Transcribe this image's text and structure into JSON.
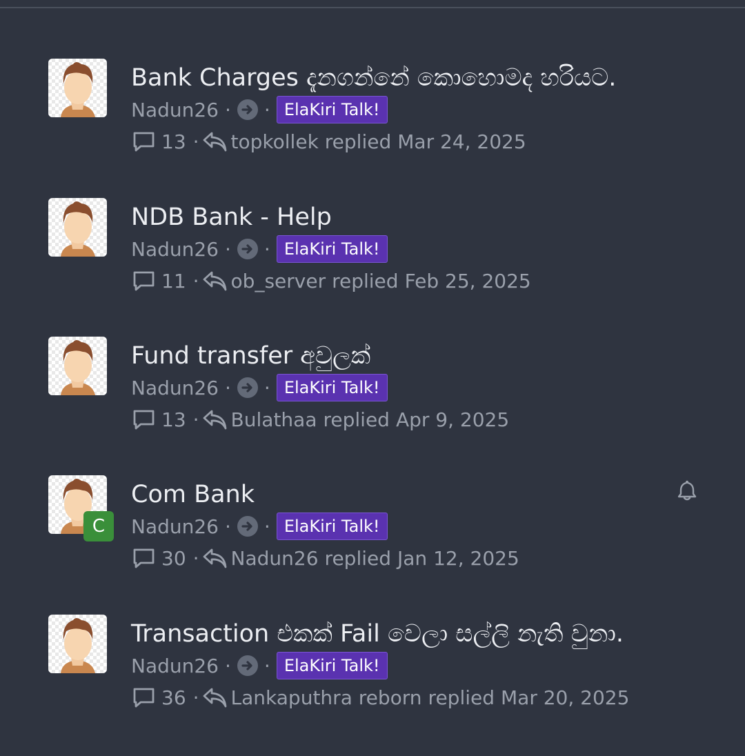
{
  "threads": [
    {
      "title": "Bank Charges දැනගන්නේ කොහොමද හරියට.",
      "author": "Nadun26",
      "forum": "ElaKiri Talk!",
      "replies": "13",
      "last_poster": "topkollek",
      "replied_word": "replied",
      "last_date": "Mar 24, 2025"
    },
    {
      "title": "NDB Bank - Help",
      "author": "Nadun26",
      "forum": "ElaKiri Talk!",
      "replies": "11",
      "last_poster": "ob_server",
      "replied_word": "replied",
      "last_date": "Feb 25, 2025"
    },
    {
      "title": "Fund transfer අවුලක්",
      "author": "Nadun26",
      "forum": "ElaKiri Talk!",
      "replies": "13",
      "last_poster": "Bulathaa",
      "replied_word": "replied",
      "last_date": "Apr 9, 2025"
    },
    {
      "title": "Com Bank",
      "author": "Nadun26",
      "forum": "ElaKiri Talk!",
      "replies": "30",
      "last_poster": "Nadun26",
      "replied_word": "replied",
      "last_date": "Jan 12, 2025",
      "avatar_badge": "C",
      "watched": true
    },
    {
      "title": "Transaction එකක් Fail වෙලා සල්ලි නැති වුනා.",
      "author": "Nadun26",
      "forum": "ElaKiri Talk!",
      "replies": "36",
      "last_poster": "Lankaputhra reborn",
      "replied_word": "replied",
      "last_date": "Mar 20, 2025"
    }
  ],
  "separator": "·",
  "icons": {
    "arrow": "arrow-right-circle-icon",
    "replies": "comment-icon",
    "last_reply": "reply-icon",
    "watch": "bell-icon"
  },
  "colors": {
    "background": "#2f3440",
    "title": "#eceef2",
    "muted": "#9aa0ab",
    "forum_tag": "#5a32b0",
    "badge": "#3a8f3a"
  }
}
